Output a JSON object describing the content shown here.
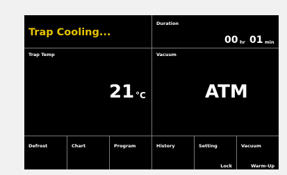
{
  "status": {
    "text": "Trap Cooling...",
    "color": "#e6c300"
  },
  "duration": {
    "label": "Duration",
    "hours": "00",
    "hours_unit": "hr",
    "minutes": "01",
    "minutes_unit": "min"
  },
  "trap_temp": {
    "label": "Trap Temp",
    "value": "21",
    "unit": "°C"
  },
  "vacuum": {
    "label": "Vacuum",
    "value": "ATM"
  },
  "buttons": [
    {
      "label": "Defrost",
      "sub": ""
    },
    {
      "label": "Chart",
      "sub": ""
    },
    {
      "label": "Program",
      "sub": ""
    },
    {
      "label": "History",
      "sub": ""
    },
    {
      "label": "Setting",
      "sub": "Lock"
    },
    {
      "label": "Vacuum",
      "sub": "Warm-Up"
    }
  ]
}
